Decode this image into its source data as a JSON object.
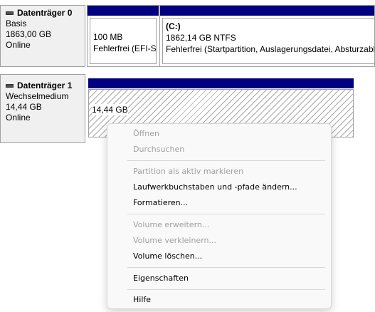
{
  "disks": [
    {
      "name": "Datenträger 0",
      "type": "Basis",
      "size": "1863,00 GB",
      "status": "Online",
      "partitions": [
        {
          "volume": "",
          "size": "100 MB",
          "status": "Fehlerfrei (EFI-Sy"
        },
        {
          "volume": "(C:)",
          "size": "1862,14 GB NTFS",
          "status": "Fehlerfrei (Startpartition, Auslagerungsdatei, Absturzabb"
        }
      ]
    },
    {
      "name": "Datenträger 1",
      "type": "Wechselmedium",
      "size": "14,44 GB",
      "status": "Online",
      "partitions": [
        {
          "volume": "",
          "size": "14,44 GB",
          "status": ""
        }
      ]
    }
  ],
  "context_menu": {
    "items": [
      {
        "label": "Öffnen",
        "enabled": false
      },
      {
        "label": "Durchsuchen",
        "enabled": false
      },
      {
        "label": "Partition als aktiv markieren",
        "enabled": false
      },
      {
        "label": "Laufwerkbuchstaben und -pfade ändern...",
        "enabled": true
      },
      {
        "label": "Formatieren...",
        "enabled": true
      },
      {
        "label": "Volume erweitern...",
        "enabled": false
      },
      {
        "label": "Volume verkleinern...",
        "enabled": false
      },
      {
        "label": "Volume löschen...",
        "enabled": true
      },
      {
        "label": "Eigenschaften",
        "enabled": true
      },
      {
        "label": "Hilfe",
        "enabled": true
      }
    ]
  }
}
